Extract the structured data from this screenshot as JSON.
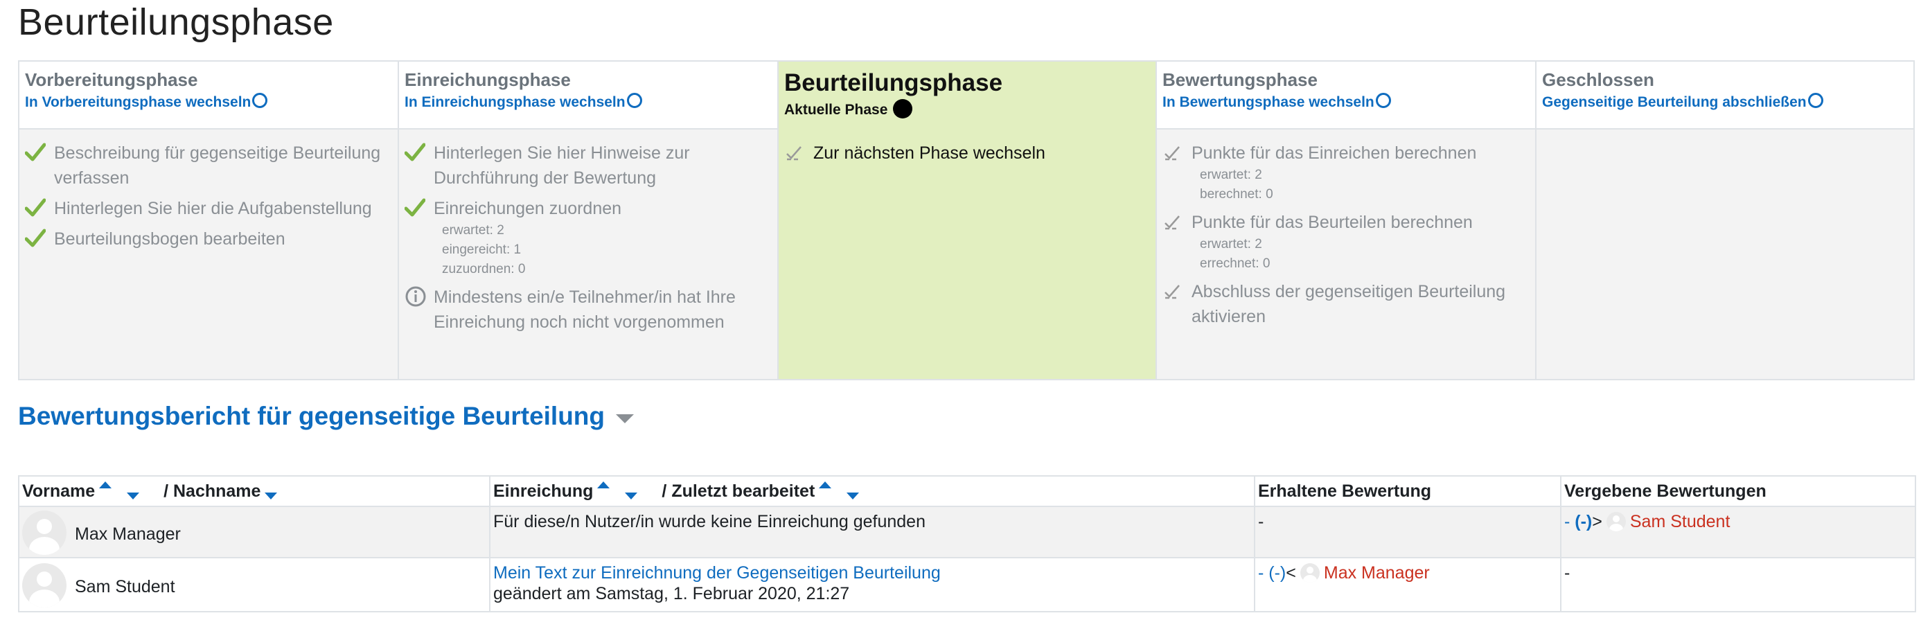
{
  "page_title": "Beurteilungsphase",
  "phases": [
    {
      "name": "Vorbereitungsphase",
      "switch_label": "In Vorbereitungsphase wechseln",
      "tasks": [
        {
          "status": "done",
          "text": "Beschreibung für gegenseitige Beurteilung verfassen"
        },
        {
          "status": "done",
          "text": "Hinterlegen Sie hier die Aufgabenstellung"
        },
        {
          "status": "done",
          "text": "Beurteilungsbogen bearbeiten"
        }
      ]
    },
    {
      "name": "Einreichungsphase",
      "switch_label": "In Einreichungsphase wechseln",
      "tasks": [
        {
          "status": "done",
          "text": "Hinterlegen Sie hier Hinweise zur Durchführung der Bewertung"
        },
        {
          "status": "done",
          "text": "Einreichungen zuordnen",
          "details": [
            "erwartet: 2",
            "eingereicht: 1",
            "zuzuordnen: 0"
          ]
        },
        {
          "status": "info",
          "text": "Mindestens ein/e Teilnehmer/in hat Ihre Einreichung noch nicht vorgenommen"
        }
      ]
    },
    {
      "name": "Beurteilungsphase",
      "current_label": "Aktuelle Phase",
      "tasks": [
        {
          "status": "todo",
          "text": "Zur nächsten Phase wechseln"
        }
      ]
    },
    {
      "name": "Bewertungsphase",
      "switch_label": "In Bewertungsphase wechseln",
      "tasks": [
        {
          "status": "todo",
          "text": "Punkte für das Einreichen berechnen",
          "details": [
            "erwartet: 2",
            "berechnet: 0"
          ]
        },
        {
          "status": "todo",
          "text": "Punkte für das Beurteilen berechnen",
          "details": [
            "erwartet: 2",
            "errechnet: 0"
          ]
        },
        {
          "status": "todo",
          "text": "Abschluss der gegenseitigen Beurteilung aktivieren"
        }
      ]
    },
    {
      "name": "Geschlossen",
      "switch_label": "Gegenseitige Beurteilung abschließen",
      "tasks": []
    }
  ],
  "report": {
    "title": "Bewertungsbericht für gegenseitige Beurteilung",
    "columns": {
      "firstname": "Vorname",
      "lastname": "/ Nachname",
      "submission": "Einreichung",
      "lastmodified": "/ Zuletzt bearbeitet",
      "received": "Erhaltene Bewertung",
      "given": "Vergebene Bewertungen"
    },
    "rows": [
      {
        "name": "Max Manager",
        "submission": "Für diese/n Nutzer/in wurde keine Einreichung gefunden",
        "submission_date": "",
        "received": "-",
        "given_prefix": "- ",
        "given_grade": "(-)",
        "given_arrow": ">",
        "given_user": "Sam Student"
      },
      {
        "name": "Sam Student",
        "submission": "Mein Text zur Einreichnung der Gegenseitigen Beurteilung",
        "submission_date": "geändert am Samstag, 1. Februar 2020, 21:27",
        "received_prefix": "- ",
        "received_grade": "(-)",
        "received_arrow": "<",
        "received_user": "Max Manager",
        "given": "-"
      }
    ]
  },
  "colors": {
    "link": "#0f6cbf",
    "active_phase_bg": "#e2efc0",
    "phase_bg": "#f3f3f3",
    "check_green": "#7cb342",
    "user_red": "#ca3120"
  }
}
